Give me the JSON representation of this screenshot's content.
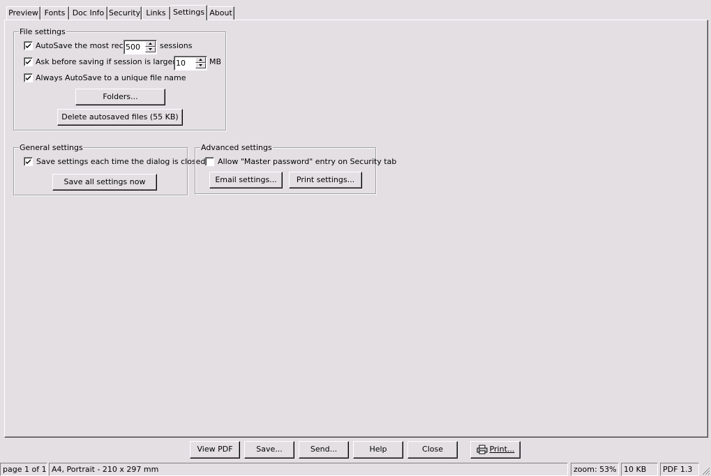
{
  "tabs": [
    "Preview",
    "Fonts",
    "Doc Info",
    "Security",
    "Links",
    "Settings",
    "About"
  ],
  "active_tab": "Settings",
  "file_settings": {
    "title": "File settings",
    "autosave_label": "AutoSave the most recent",
    "autosave_checked": true,
    "autosave_value": "500",
    "sessions_label": "sessions",
    "ask_label": "Ask before saving if session is larger than",
    "ask_checked": true,
    "ask_value": "10",
    "mb_label": "MB",
    "unique_label": "Always AutoSave to a unique file name",
    "unique_checked": true,
    "folders_button": "Folders...",
    "delete_button": "Delete autosaved files (55 KB)"
  },
  "general_settings": {
    "title": "General settings",
    "save_label": "Save settings each time the dialog is closed",
    "save_checked": true,
    "save_all_button": "Save all settings now"
  },
  "advanced_settings": {
    "title": "Advanced settings",
    "master_label": "Allow \"Master password\" entry on Security tab",
    "master_checked": false,
    "email_button": "Email settings...",
    "print_button": "Print settings..."
  },
  "bottom_buttons": {
    "view_pdf": "View PDF",
    "save": "Save...",
    "send": "Send...",
    "help": "Help",
    "close": "Close",
    "print": "Print..."
  },
  "status": {
    "page": "page 1 of 1",
    "paper": "A4, Portrait - 210 x 297 mm",
    "zoom": "zoom: 53%",
    "size": "10 KB",
    "pdf_version": "PDF 1.3"
  },
  "icons": {
    "check": "check-icon",
    "spin_up": "spin-up-arrow-icon",
    "spin_down": "spin-down-arrow-icon",
    "printer": "printer-icon",
    "grip": "size-grip-icon"
  }
}
